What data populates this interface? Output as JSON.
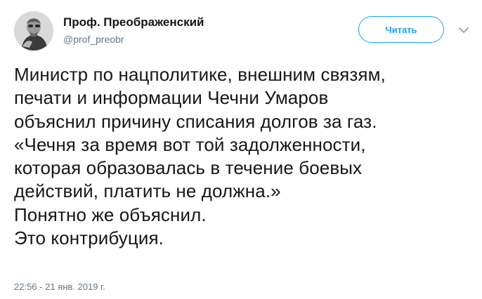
{
  "author": {
    "display_name": "Проф. Преображенский",
    "handle": "@prof_preobr"
  },
  "follow_button": {
    "label": "Читать",
    "color": "#1da1f2"
  },
  "menu": {
    "icon": "chevron-down-icon"
  },
  "tweet": {
    "lines": [
      "Министр по нацполитике, внешним связям,",
      "печати и информации Чечни Умаров",
      "объяснил причину списания долгов за газ.",
      "«Чечня за время вот той задолженности,",
      "которая образовалась в течение боевых",
      "действий, платить не должна.»",
      "Понятно же объяснил.",
      "Это контрибуция."
    ],
    "timestamp": "22:56 - 21 янв. 2019 г."
  }
}
